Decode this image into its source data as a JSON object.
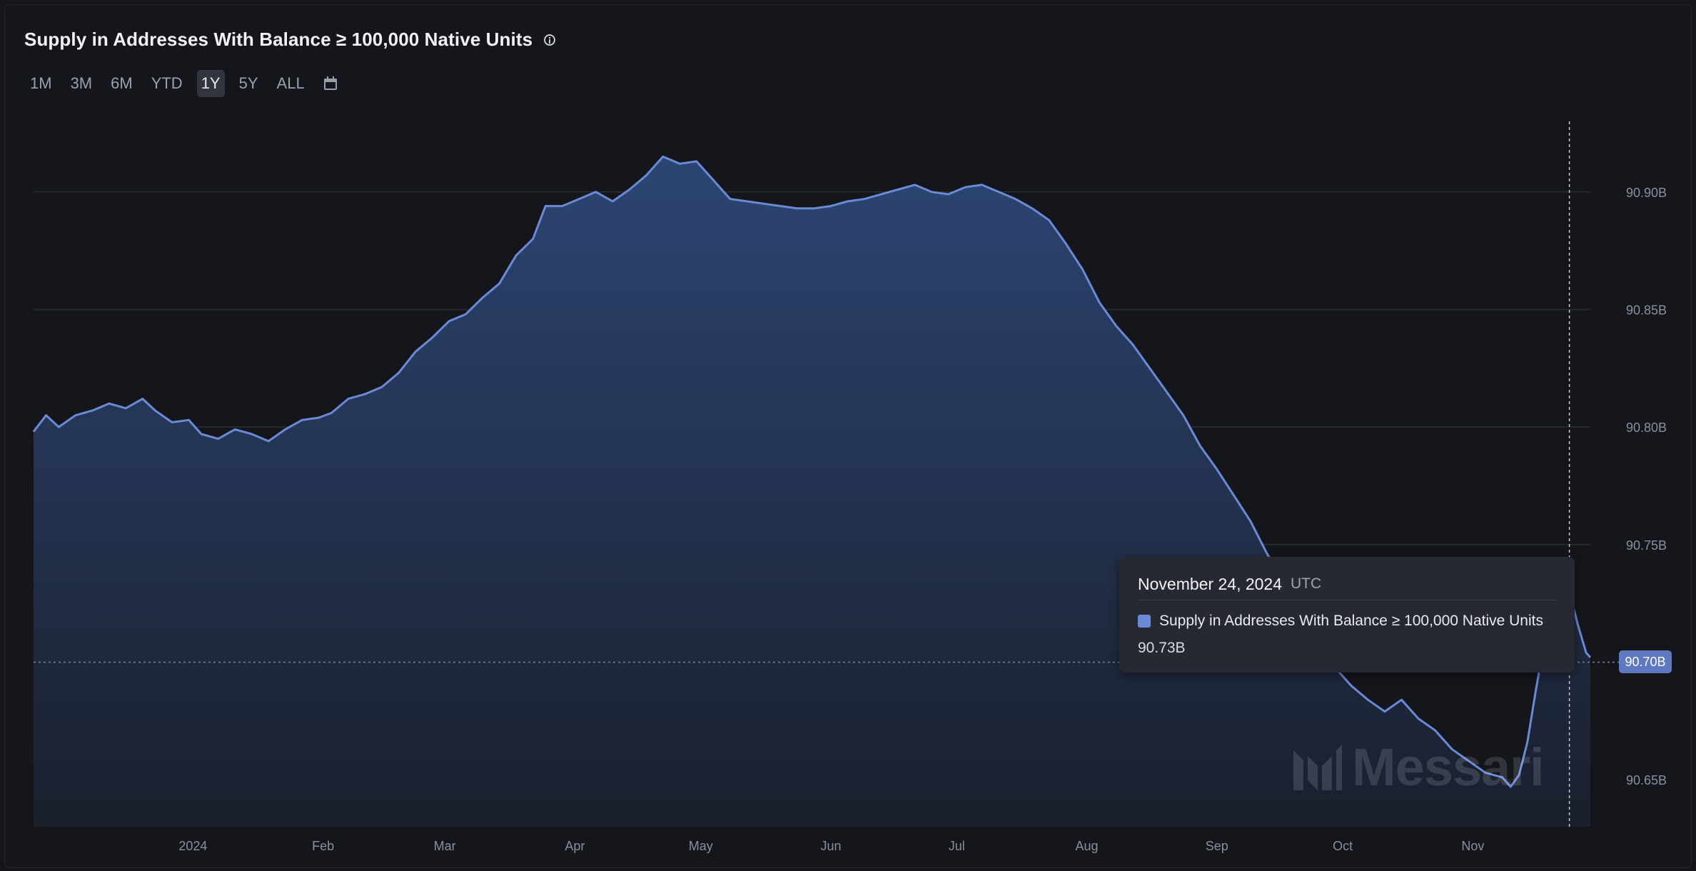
{
  "header": {
    "title": "Supply in Addresses With Balance ≥ 100,000 Native Units"
  },
  "ranges": {
    "options": [
      "1M",
      "3M",
      "6M",
      "YTD",
      "1Y",
      "5Y",
      "ALL"
    ],
    "selected": "1Y"
  },
  "icons": {
    "info": "info-icon",
    "calendar": "calendar-icon",
    "logo": "messari-logo-icon"
  },
  "tooltip": {
    "date": "November 24, 2024",
    "timezone": "UTC",
    "series_name": "Supply in Addresses With Balance ≥ 100,000 Native Units",
    "value": "90.73B"
  },
  "crosshair": {
    "value_badge": "90.70B"
  },
  "watermark": {
    "text": "Messari"
  },
  "colors": {
    "line": "#6b8ad6",
    "fill_top": "#2c4573",
    "fill_bottom": "#1a1f2c",
    "background": "#14161c",
    "grid": "#2a2e37",
    "badge": "#5e79c0"
  },
  "chart_data": {
    "type": "area",
    "title": "Supply in Addresses With Balance ≥ 100,000 Native Units",
    "y_unit": "B",
    "ylim": [
      90.63,
      90.93
    ],
    "y_ticks": [
      90.65,
      90.7,
      90.75,
      90.8,
      90.85,
      90.9
    ],
    "y_tick_labels": [
      "90.65B",
      "90.70B",
      "90.75B",
      "90.80B",
      "90.85B",
      "90.90B"
    ],
    "x_range": [
      "2023-11-24",
      "2024-11-29"
    ],
    "x_ticks": [
      {
        "date": "2024-01-01",
        "label": "2024"
      },
      {
        "date": "2024-02-01",
        "label": "Feb"
      },
      {
        "date": "2024-03-01",
        "label": "Mar"
      },
      {
        "date": "2024-04-01",
        "label": "Apr"
      },
      {
        "date": "2024-05-01",
        "label": "May"
      },
      {
        "date": "2024-06-01",
        "label": "Jun"
      },
      {
        "date": "2024-07-01",
        "label": "Jul"
      },
      {
        "date": "2024-08-01",
        "label": "Aug"
      },
      {
        "date": "2024-09-01",
        "label": "Sep"
      },
      {
        "date": "2024-10-01",
        "label": "Oct"
      },
      {
        "date": "2024-11-01",
        "label": "Nov"
      }
    ],
    "grid": "horizontal",
    "legend": "none",
    "highlight": {
      "date": "2024-11-24",
      "value": 90.73
    },
    "series": [
      {
        "name": "Supply in Addresses With Balance ≥ 100,000 Native Units",
        "points": [
          [
            "2023-11-24",
            90.798
          ],
          [
            "2023-11-27",
            90.805
          ],
          [
            "2023-11-30",
            90.8
          ],
          [
            "2023-12-04",
            90.805
          ],
          [
            "2023-12-08",
            90.807
          ],
          [
            "2023-12-12",
            90.81
          ],
          [
            "2023-12-16",
            90.808
          ],
          [
            "2023-12-20",
            90.812
          ],
          [
            "2023-12-23",
            90.807
          ],
          [
            "2023-12-27",
            90.802
          ],
          [
            "2023-12-31",
            90.803
          ],
          [
            "2024-01-03",
            90.797
          ],
          [
            "2024-01-07",
            90.795
          ],
          [
            "2024-01-11",
            90.799
          ],
          [
            "2024-01-15",
            90.797
          ],
          [
            "2024-01-19",
            90.794
          ],
          [
            "2024-01-23",
            90.799
          ],
          [
            "2024-01-27",
            90.803
          ],
          [
            "2024-01-31",
            90.804
          ],
          [
            "2024-02-03",
            90.806
          ],
          [
            "2024-02-07",
            90.812
          ],
          [
            "2024-02-11",
            90.814
          ],
          [
            "2024-02-15",
            90.817
          ],
          [
            "2024-02-19",
            90.823
          ],
          [
            "2024-02-23",
            90.832
          ],
          [
            "2024-02-27",
            90.838
          ],
          [
            "2024-03-02",
            90.845
          ],
          [
            "2024-03-06",
            90.848
          ],
          [
            "2024-03-10",
            90.855
          ],
          [
            "2024-03-14",
            90.861
          ],
          [
            "2024-03-18",
            90.873
          ],
          [
            "2024-03-22",
            90.88
          ],
          [
            "2024-03-25",
            90.894
          ],
          [
            "2024-03-29",
            90.894
          ],
          [
            "2024-04-02",
            90.897
          ],
          [
            "2024-04-06",
            90.9
          ],
          [
            "2024-04-10",
            90.896
          ],
          [
            "2024-04-14",
            90.901
          ],
          [
            "2024-04-18",
            90.907
          ],
          [
            "2024-04-22",
            90.915
          ],
          [
            "2024-04-26",
            90.912
          ],
          [
            "2024-04-30",
            90.913
          ],
          [
            "2024-05-04",
            90.905
          ],
          [
            "2024-05-08",
            90.897
          ],
          [
            "2024-05-12",
            90.896
          ],
          [
            "2024-05-16",
            90.895
          ],
          [
            "2024-05-20",
            90.894
          ],
          [
            "2024-05-24",
            90.893
          ],
          [
            "2024-05-28",
            90.893
          ],
          [
            "2024-06-01",
            90.894
          ],
          [
            "2024-06-05",
            90.896
          ],
          [
            "2024-06-09",
            90.897
          ],
          [
            "2024-06-13",
            90.899
          ],
          [
            "2024-06-17",
            90.901
          ],
          [
            "2024-06-21",
            90.903
          ],
          [
            "2024-06-25",
            90.9
          ],
          [
            "2024-06-29",
            90.899
          ],
          [
            "2024-07-03",
            90.902
          ],
          [
            "2024-07-07",
            90.903
          ],
          [
            "2024-07-11",
            90.9
          ],
          [
            "2024-07-15",
            90.897
          ],
          [
            "2024-07-19",
            90.893
          ],
          [
            "2024-07-23",
            90.888
          ],
          [
            "2024-07-27",
            90.878
          ],
          [
            "2024-07-31",
            90.867
          ],
          [
            "2024-08-04",
            90.853
          ],
          [
            "2024-08-08",
            90.843
          ],
          [
            "2024-08-12",
            90.835
          ],
          [
            "2024-08-16",
            90.825
          ],
          [
            "2024-08-20",
            90.815
          ],
          [
            "2024-08-24",
            90.805
          ],
          [
            "2024-08-28",
            90.792
          ],
          [
            "2024-09-01",
            90.782
          ],
          [
            "2024-09-05",
            90.771
          ],
          [
            "2024-09-09",
            90.76
          ],
          [
            "2024-09-13",
            90.746
          ],
          [
            "2024-09-17",
            90.735
          ],
          [
            "2024-09-21",
            90.722
          ],
          [
            "2024-09-25",
            90.709
          ],
          [
            "2024-09-29",
            90.698
          ],
          [
            "2024-10-03",
            90.69
          ],
          [
            "2024-10-07",
            90.684
          ],
          [
            "2024-10-11",
            90.679
          ],
          [
            "2024-10-15",
            90.684
          ],
          [
            "2024-10-19",
            90.676
          ],
          [
            "2024-10-23",
            90.671
          ],
          [
            "2024-10-27",
            90.663
          ],
          [
            "2024-10-31",
            90.658
          ],
          [
            "2024-11-04",
            90.653
          ],
          [
            "2024-11-08",
            90.651
          ],
          [
            "2024-11-10",
            90.647
          ],
          [
            "2024-11-12",
            90.652
          ],
          [
            "2024-11-14",
            90.666
          ],
          [
            "2024-11-16",
            90.688
          ],
          [
            "2024-11-18",
            90.708
          ],
          [
            "2024-11-20",
            90.718
          ],
          [
            "2024-11-22",
            90.71
          ],
          [
            "2024-11-24",
            90.73
          ],
          [
            "2024-11-26",
            90.716
          ],
          [
            "2024-11-28",
            90.704
          ],
          [
            "2024-11-29",
            90.702
          ]
        ]
      }
    ]
  }
}
